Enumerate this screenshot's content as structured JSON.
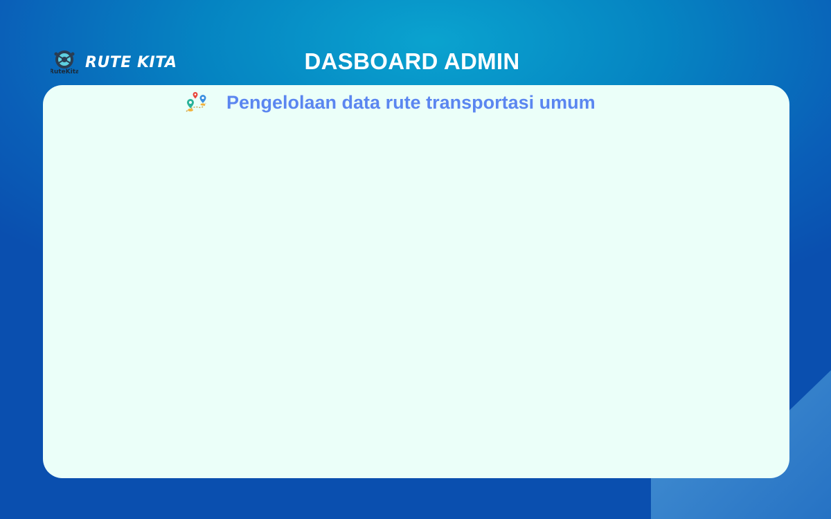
{
  "header": {
    "brand_name": "RUTE KITA",
    "brand_logo_text": "RuteKita",
    "title": "DASBOARD ADMIN"
  },
  "panel": {
    "heading": "Pengelolaan data rute transportasi umum",
    "heading_icon": "map-pins-icon"
  },
  "colors": {
    "background": "#0584c2",
    "panel": "#ebfff9",
    "heading": "#5b86f0",
    "title": "#ffffff"
  }
}
